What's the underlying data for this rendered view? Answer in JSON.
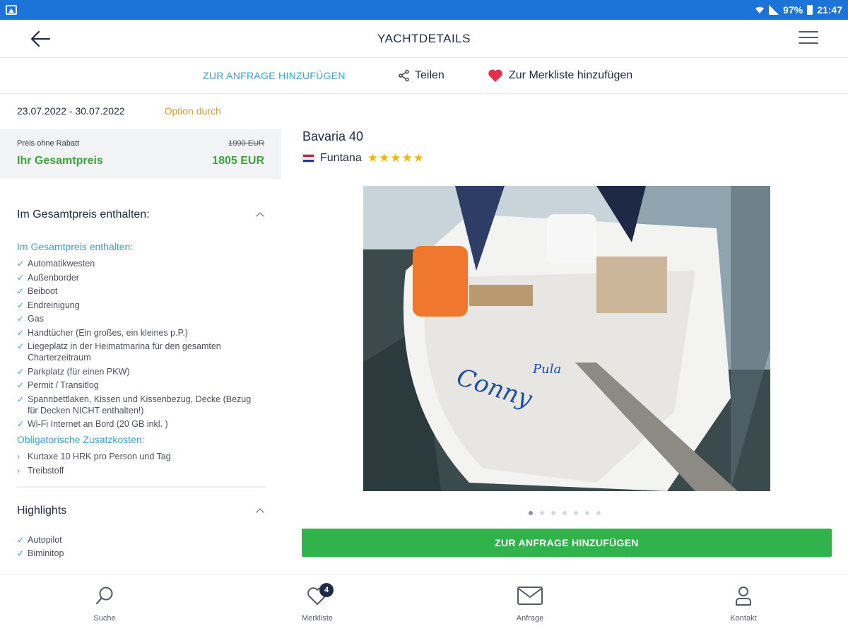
{
  "status_bar": {
    "wifi": "wifi-icon",
    "battery_percent": "97%",
    "time": "21:47"
  },
  "header": {
    "title": "YACHTDETAILS"
  },
  "actions": {
    "add_to_request": "ZUR ANFRAGE HINZUFÜGEN",
    "share": "Teilen",
    "wishlist": "Zur Merkliste hinzufügen"
  },
  "booking": {
    "dates": "23.07.2022 - 30.07.2022",
    "status": "Option durch"
  },
  "price": {
    "without_discount_label": "Preis ohne Rabatt",
    "without_discount_value": "1990 EUR",
    "total_label": "Ihr Gesamtpreis",
    "total_value": "1805 EUR"
  },
  "included_section": {
    "title": "Im Gesamtpreis enthalten:",
    "subtitle": "Im Gesamtpreis enthalten:",
    "items": [
      "Automatikwesten",
      "Außenborder",
      "Beiboot",
      "Endreinigung",
      "Gas",
      "Handtücher (Ein großes, ein kleines p.P.)",
      "Liegeplatz in der Heimatmarina für den gesamten Charterzeitraum",
      "Parkplatz (für einen PKW)",
      "Permit / Transitlog",
      "Spannbettlaken, Kissen und Kissenbezug, Decke (Bezug für Decken NICHT enthalten!)",
      "Wi-Fi Internet an Bord (20 GB inkl. )"
    ],
    "mandatory_title": "Obligatorische Zusatzkosten:",
    "mandatory_items": [
      "Kurtaxe 10 HRK pro Person und Tag",
      "Treibstoff"
    ]
  },
  "highlights_section": {
    "title": "Highlights",
    "items": [
      "Autopilot",
      "Biminitop"
    ]
  },
  "yacht": {
    "name": "Bavaria 40",
    "location": "Funtana",
    "country_flag": "croatia-flag",
    "stars": "★★★★★",
    "rating": 5,
    "hull_name": "Conny",
    "hull_port": "Pula"
  },
  "gallery": {
    "image_count": 7,
    "active_index": 0
  },
  "cta": {
    "label": "ZUR ANFRAGE HINZUFÜGEN"
  },
  "bottom_nav": [
    {
      "label": "Suche",
      "icon": "search-icon"
    },
    {
      "label": "Merkliste",
      "icon": "heart-icon",
      "badge": "4"
    },
    {
      "label": "Anfrage",
      "icon": "mail-icon"
    },
    {
      "label": "Kontakt",
      "icon": "person-icon"
    }
  ],
  "colors": {
    "status_bar": "#1c74d8",
    "accent_blue": "#3aa3d6",
    "price_green": "#3aa33a",
    "cta_green": "#2fb34a",
    "option_orange": "#d19a2a",
    "heart_red": "#e0304a",
    "star_yellow": "#f2b705",
    "navy": "#1f2a44"
  }
}
